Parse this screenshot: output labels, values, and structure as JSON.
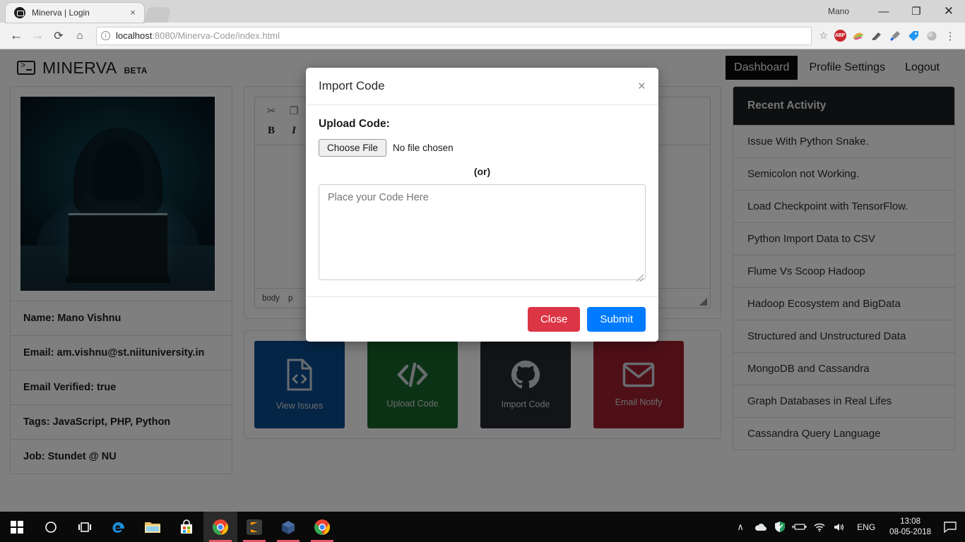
{
  "browser": {
    "tab": {
      "title": "Minerva | Login",
      "favicon": "minerva-favicon",
      "close": "×"
    },
    "window_user": "Mano",
    "window_buttons": {
      "minimize": "—",
      "maximize": "❐",
      "close": "✕"
    },
    "nav": {
      "back": "←",
      "forward": "→",
      "reload": "⟳",
      "home": "⌂"
    },
    "omnibox": {
      "security_icon": "info-circle",
      "url_host": "localhost",
      "url_path": ":8080/Minerva-Code/index.html",
      "star": "☆"
    },
    "extensions": [
      {
        "name": "adblock-plus-icon",
        "label": "ABP"
      },
      {
        "name": "colorful-extension-icon",
        "label": ""
      },
      {
        "name": "paint-extension-icon",
        "label": ""
      },
      {
        "name": "eyedropper-extension-icon",
        "label": ""
      },
      {
        "name": "tag-extension-icon",
        "label": ""
      },
      {
        "name": "grey-extension-icon",
        "label": ""
      }
    ],
    "menu": "⋮"
  },
  "app": {
    "brand": {
      "name": "MINERVA",
      "beta": "BETA",
      "icon": "terminal-icon"
    },
    "nav": [
      {
        "label": "Dashboard",
        "active": true
      },
      {
        "label": "Profile Settings",
        "active": false
      },
      {
        "label": "Logout",
        "active": false
      }
    ]
  },
  "profile": {
    "photo_alt": "hooded-hacker-at-laptop",
    "rows": [
      "Name: Mano Vishnu",
      "Email: am.vishnu@st.niituniversity.in",
      "Email Verified: true",
      "Tags: JavaScript, PHP, Python",
      "Job: Stundet @ NU"
    ]
  },
  "editor": {
    "toolbar_row1": [
      {
        "name": "cut-icon",
        "glyph": "✂"
      },
      {
        "name": "copy-icon",
        "glyph": "❐"
      }
    ],
    "toolbar_row2": [
      {
        "name": "bold-icon",
        "glyph": "B"
      },
      {
        "name": "italic-icon",
        "glyph": "I"
      }
    ],
    "status_path": [
      "body",
      "p"
    ],
    "resize_grip": "resize-grip"
  },
  "tiles": [
    {
      "label": "View Issues",
      "icon": "file-code-icon",
      "color": "#0b4a8f"
    },
    {
      "label": "Upload Code",
      "icon": "code-icon",
      "color": "#17642a"
    },
    {
      "label": "Import Code",
      "icon": "github-icon",
      "color": "#24292e"
    },
    {
      "label": "Email Notify",
      "icon": "envelope-icon",
      "color": "#9e1f2f"
    }
  ],
  "activity": {
    "title": "Recent Activity",
    "items": [
      "Issue With Python Snake.",
      "Semicolon not Working.",
      "Load Checkpoint with TensorFlow.",
      "Python Import Data to CSV",
      "Flume Vs Scoop Hadoop",
      "Hadoop Ecosystem and BigData",
      "Structured and Unstructured Data",
      "MongoDB and Cassandra",
      "Graph Databases in Real Lifes",
      "Cassandra Query Language"
    ]
  },
  "modal": {
    "title": "Import Code",
    "close_icon": "×",
    "upload_label": "Upload Code:",
    "choose_file_button": "Choose File",
    "file_status": "No file chosen",
    "or_text": "(or)",
    "textarea_placeholder": "Place your Code Here",
    "textarea_value": "",
    "close_button": "Close",
    "submit_button": "Submit"
  },
  "taskbar": {
    "items": [
      {
        "name": "start-button",
        "state": "idle"
      },
      {
        "name": "cortana-button",
        "state": "idle"
      },
      {
        "name": "task-view-button",
        "state": "idle"
      },
      {
        "name": "edge-icon",
        "state": "idle"
      },
      {
        "name": "file-explorer-icon",
        "state": "idle"
      },
      {
        "name": "microsoft-store-icon",
        "state": "idle"
      },
      {
        "name": "chrome-icon",
        "state": "active"
      },
      {
        "name": "sublime-text-icon",
        "state": "running"
      },
      {
        "name": "virtualbox-icon",
        "state": "running"
      },
      {
        "name": "chrome-icon-2",
        "state": "running"
      }
    ],
    "tray": {
      "chevron": "∧",
      "icons": [
        "onedrive-icon",
        "windows-defender-icon",
        "battery-icon",
        "wifi-icon",
        "volume-icon"
      ],
      "language": "ENG",
      "time": "13:08",
      "date": "08-05-2018",
      "action_center": "action-center-icon"
    }
  }
}
